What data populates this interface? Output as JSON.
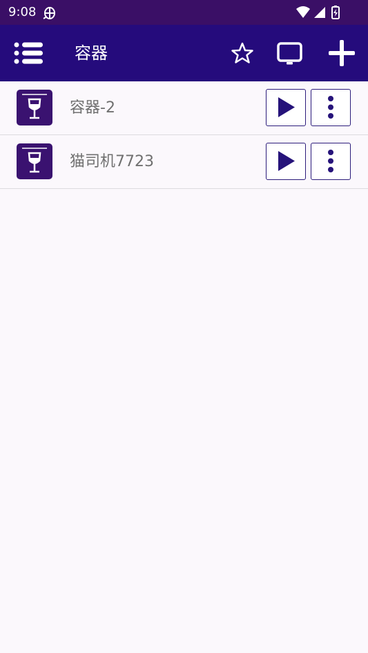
{
  "status_bar": {
    "time": "9:08",
    "notification_icon": "bug-icon",
    "icons": [
      "wifi-icon",
      "signal-icon",
      "battery-charging-icon"
    ]
  },
  "app_bar": {
    "title": "容器",
    "actions": [
      "menu-icon",
      "star-icon",
      "monitor-icon",
      "plus-icon"
    ]
  },
  "containers": [
    {
      "name": "容器-2",
      "icon": "wine-glass-icon"
    },
    {
      "name": "猫司机7723",
      "icon": "wine-glass-icon"
    }
  ],
  "colors": {
    "status_bar": "#3a0f66",
    "app_bar": "#250b7c",
    "accent": "#2a1a7a",
    "background": "#fbf8fc",
    "item_text": "#707070"
  }
}
